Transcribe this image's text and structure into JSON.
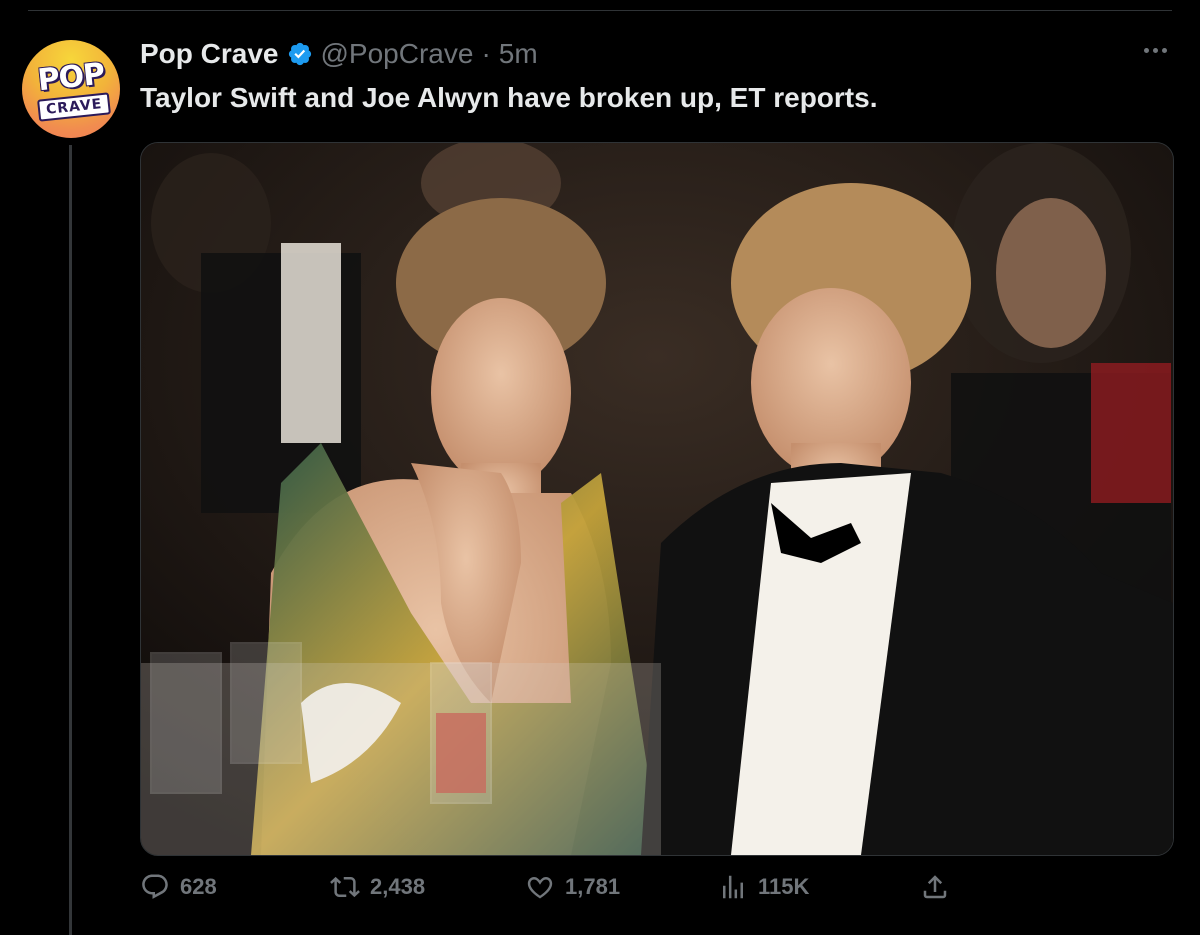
{
  "tweet": {
    "display_name": "Pop Crave",
    "handle": "@PopCrave",
    "separator": "·",
    "time": "5m",
    "text": "Taylor Swift and Joe Alwyn have broken up, ET reports.",
    "avatar": {
      "line1": "POP",
      "line2": "CRAVE"
    },
    "verified": true,
    "accent": "#1d9bf0"
  },
  "actions": {
    "replies": "628",
    "retweets": "2,438",
    "likes": "1,781",
    "views": "115K"
  },
  "icons": [
    "verified-badge-icon",
    "more-icon",
    "reply-icon",
    "retweet-icon",
    "like-icon",
    "views-icon",
    "share-icon"
  ]
}
